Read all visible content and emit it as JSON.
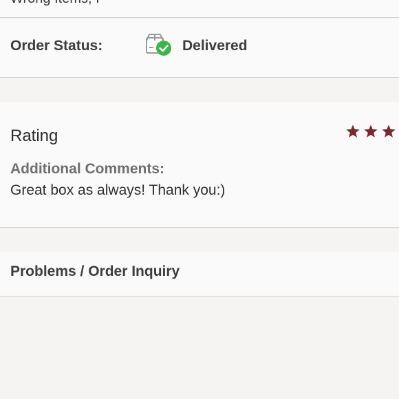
{
  "top_strip": {
    "clipped_text": "Wrong Items, I"
  },
  "order_status": {
    "label": "Order Status:",
    "icon": "box-delivered-icon",
    "value": "Delivered",
    "check_color": "#3cb44b"
  },
  "rating": {
    "title": "Rating",
    "visible_stars": 3,
    "star_color": "#7a2734",
    "comments_label": "Additional Comments:",
    "comments_text": "Great box as always! Thank you:)"
  },
  "problems": {
    "label": "Problems / Order Inquiry"
  }
}
